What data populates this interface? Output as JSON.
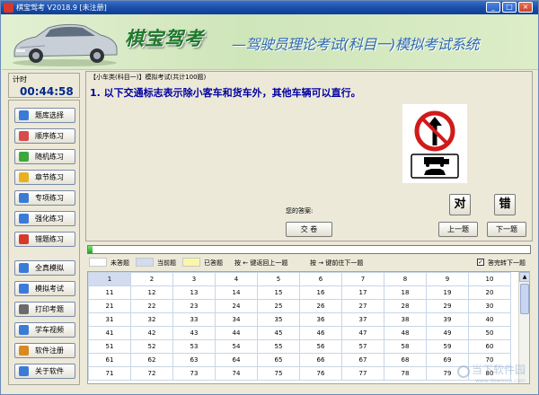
{
  "window": {
    "title": "棋宝驾考 V2018.9 [未注册]",
    "min": "_",
    "max": "□",
    "close": "×"
  },
  "banner": {
    "brand": "棋宝驾考",
    "subtitle": "—驾驶员理论考试(科目一)模拟考试系统"
  },
  "timer": {
    "label": "计时",
    "value": "00:44:58"
  },
  "nav": {
    "items": [
      {
        "label": "题库选择",
        "icon": "cubes-icon",
        "color": "#3b7bd8"
      },
      {
        "label": "顺序练习",
        "icon": "list-icon",
        "color": "#d84b4b"
      },
      {
        "label": "随机练习",
        "icon": "shuffle-icon",
        "color": "#3aa83a"
      },
      {
        "label": "章节练习",
        "icon": "folder-icon",
        "color": "#e7b21e"
      },
      {
        "label": "专项练习",
        "icon": "checklist-icon",
        "color": "#3b7bd8"
      },
      {
        "label": "强化练习",
        "icon": "checklist-icon",
        "color": "#3b7bd8"
      },
      {
        "label": "错题练习",
        "icon": "flag-icon",
        "color": "#d8382a"
      },
      {
        "label": "全真模拟",
        "icon": "grid-icon",
        "color": "#3b7bd8"
      },
      {
        "label": "模拟考试",
        "icon": "monitor-icon",
        "color": "#3b7bd8"
      },
      {
        "label": "打印考题",
        "icon": "printer-icon",
        "color": "#6a6a6a"
      },
      {
        "label": "学车视频",
        "icon": "video-icon",
        "color": "#3b7bd8"
      },
      {
        "label": "软件注册",
        "icon": "pen-icon",
        "color": "#d88a1e"
      },
      {
        "label": "关于软件",
        "icon": "info-icon",
        "color": "#3b7bd8"
      }
    ]
  },
  "question": {
    "header": "【小车类(科目一)】模拟考试(共计100题)",
    "text": "1. 以下交通标志表示除小客车和货车外，其他车辆可以直行。",
    "answer_label": "您的答案:"
  },
  "buttons": {
    "submit": "交 卷",
    "right": "对",
    "wrong": "错",
    "prev": "上一题",
    "next": "下一题"
  },
  "progress": {
    "value": 0.01
  },
  "legend": {
    "unanswered": "未答题",
    "current": "当前题",
    "answered": "已答题",
    "key_back": "按 ← 键返回上一题",
    "key_forward": "按 → 键前往下一题",
    "auto_next_label": "答完转下一题",
    "auto_next_checked": true,
    "colors": {
      "unanswered": "#ffffff",
      "current": "#d2dbef",
      "answered": "#fbf7a6"
    }
  },
  "grid": {
    "rows": [
      [
        "1",
        "2",
        "3",
        "4",
        "5",
        "6",
        "7",
        "8",
        "9",
        "10"
      ],
      [
        "11",
        "12",
        "13",
        "14",
        "15",
        "16",
        "17",
        "18",
        "19",
        "20"
      ],
      [
        "21",
        "22",
        "23",
        "24",
        "25",
        "26",
        "27",
        "28",
        "29",
        "30"
      ],
      [
        "31",
        "32",
        "33",
        "34",
        "35",
        "36",
        "37",
        "38",
        "39",
        "40"
      ],
      [
        "41",
        "42",
        "43",
        "44",
        "45",
        "46",
        "47",
        "48",
        "49",
        "50"
      ],
      [
        "51",
        "52",
        "53",
        "54",
        "55",
        "56",
        "57",
        "58",
        "59",
        "60"
      ],
      [
        "61",
        "62",
        "63",
        "64",
        "65",
        "66",
        "67",
        "68",
        "69",
        "70"
      ],
      [
        "71",
        "72",
        "73",
        "74",
        "75",
        "76",
        "77",
        "78",
        "79",
        "80"
      ]
    ],
    "current": "1"
  },
  "watermark": {
    "line1": "当下软件园",
    "line2": "www.downxia.com"
  }
}
